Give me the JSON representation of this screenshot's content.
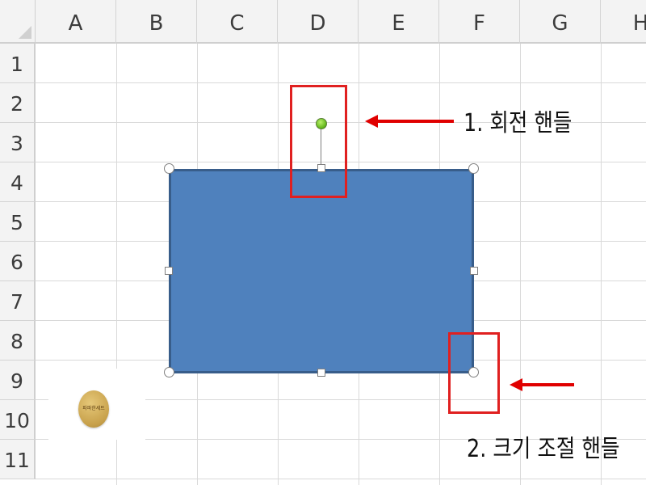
{
  "spreadsheet": {
    "columns": [
      "A",
      "B",
      "C",
      "D",
      "E",
      "F",
      "G",
      "H"
    ],
    "rows": [
      "1",
      "2",
      "3",
      "4",
      "5",
      "6",
      "7",
      "8",
      "9",
      "10",
      "11"
    ]
  },
  "shape": {
    "type": "rectangle",
    "fill_color": "#4f81bd",
    "border_color": "#385d8a",
    "rotation_handle_color": "#5fb417"
  },
  "annotations": {
    "highlight_color": "#e02020",
    "rotation_handle_label": "1. 회전 핸들",
    "resize_handle_label": "2. 크기 조절 핸들"
  },
  "watermark": {
    "text": "파파한세트"
  }
}
